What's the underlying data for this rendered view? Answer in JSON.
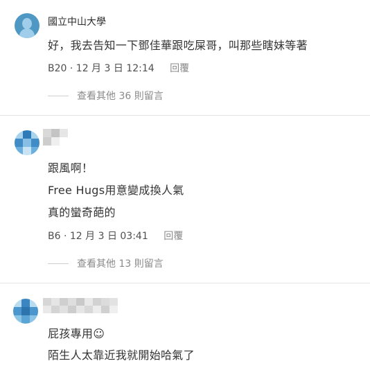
{
  "comments": [
    {
      "author": "國立中山大學",
      "lines": [
        "好，我去告知一下鄧佳華跟吃屎哥，叫那些瞎妹等著"
      ],
      "floor": "B20",
      "date": "12 月 3 日 12:14",
      "reply_label": "回覆",
      "more_label": "查看其他 36 則留言"
    },
    {
      "author": "",
      "lines": [
        "跟風啊！",
        "Free Hugs用意變成換人氣",
        "真的蠻奇葩的"
      ],
      "floor": "B6",
      "date": "12 月 3 日 03:41",
      "reply_label": "回覆",
      "more_label": "查看其他 13 則留言"
    },
    {
      "author": "",
      "lines": [
        "屁孩專用☺",
        "陌生人太靠近我就開始哈氣了"
      ]
    }
  ],
  "meta_separator": "·",
  "colors": {
    "avatar_default": "#4f98c4",
    "divider": "#e4e4e4"
  }
}
